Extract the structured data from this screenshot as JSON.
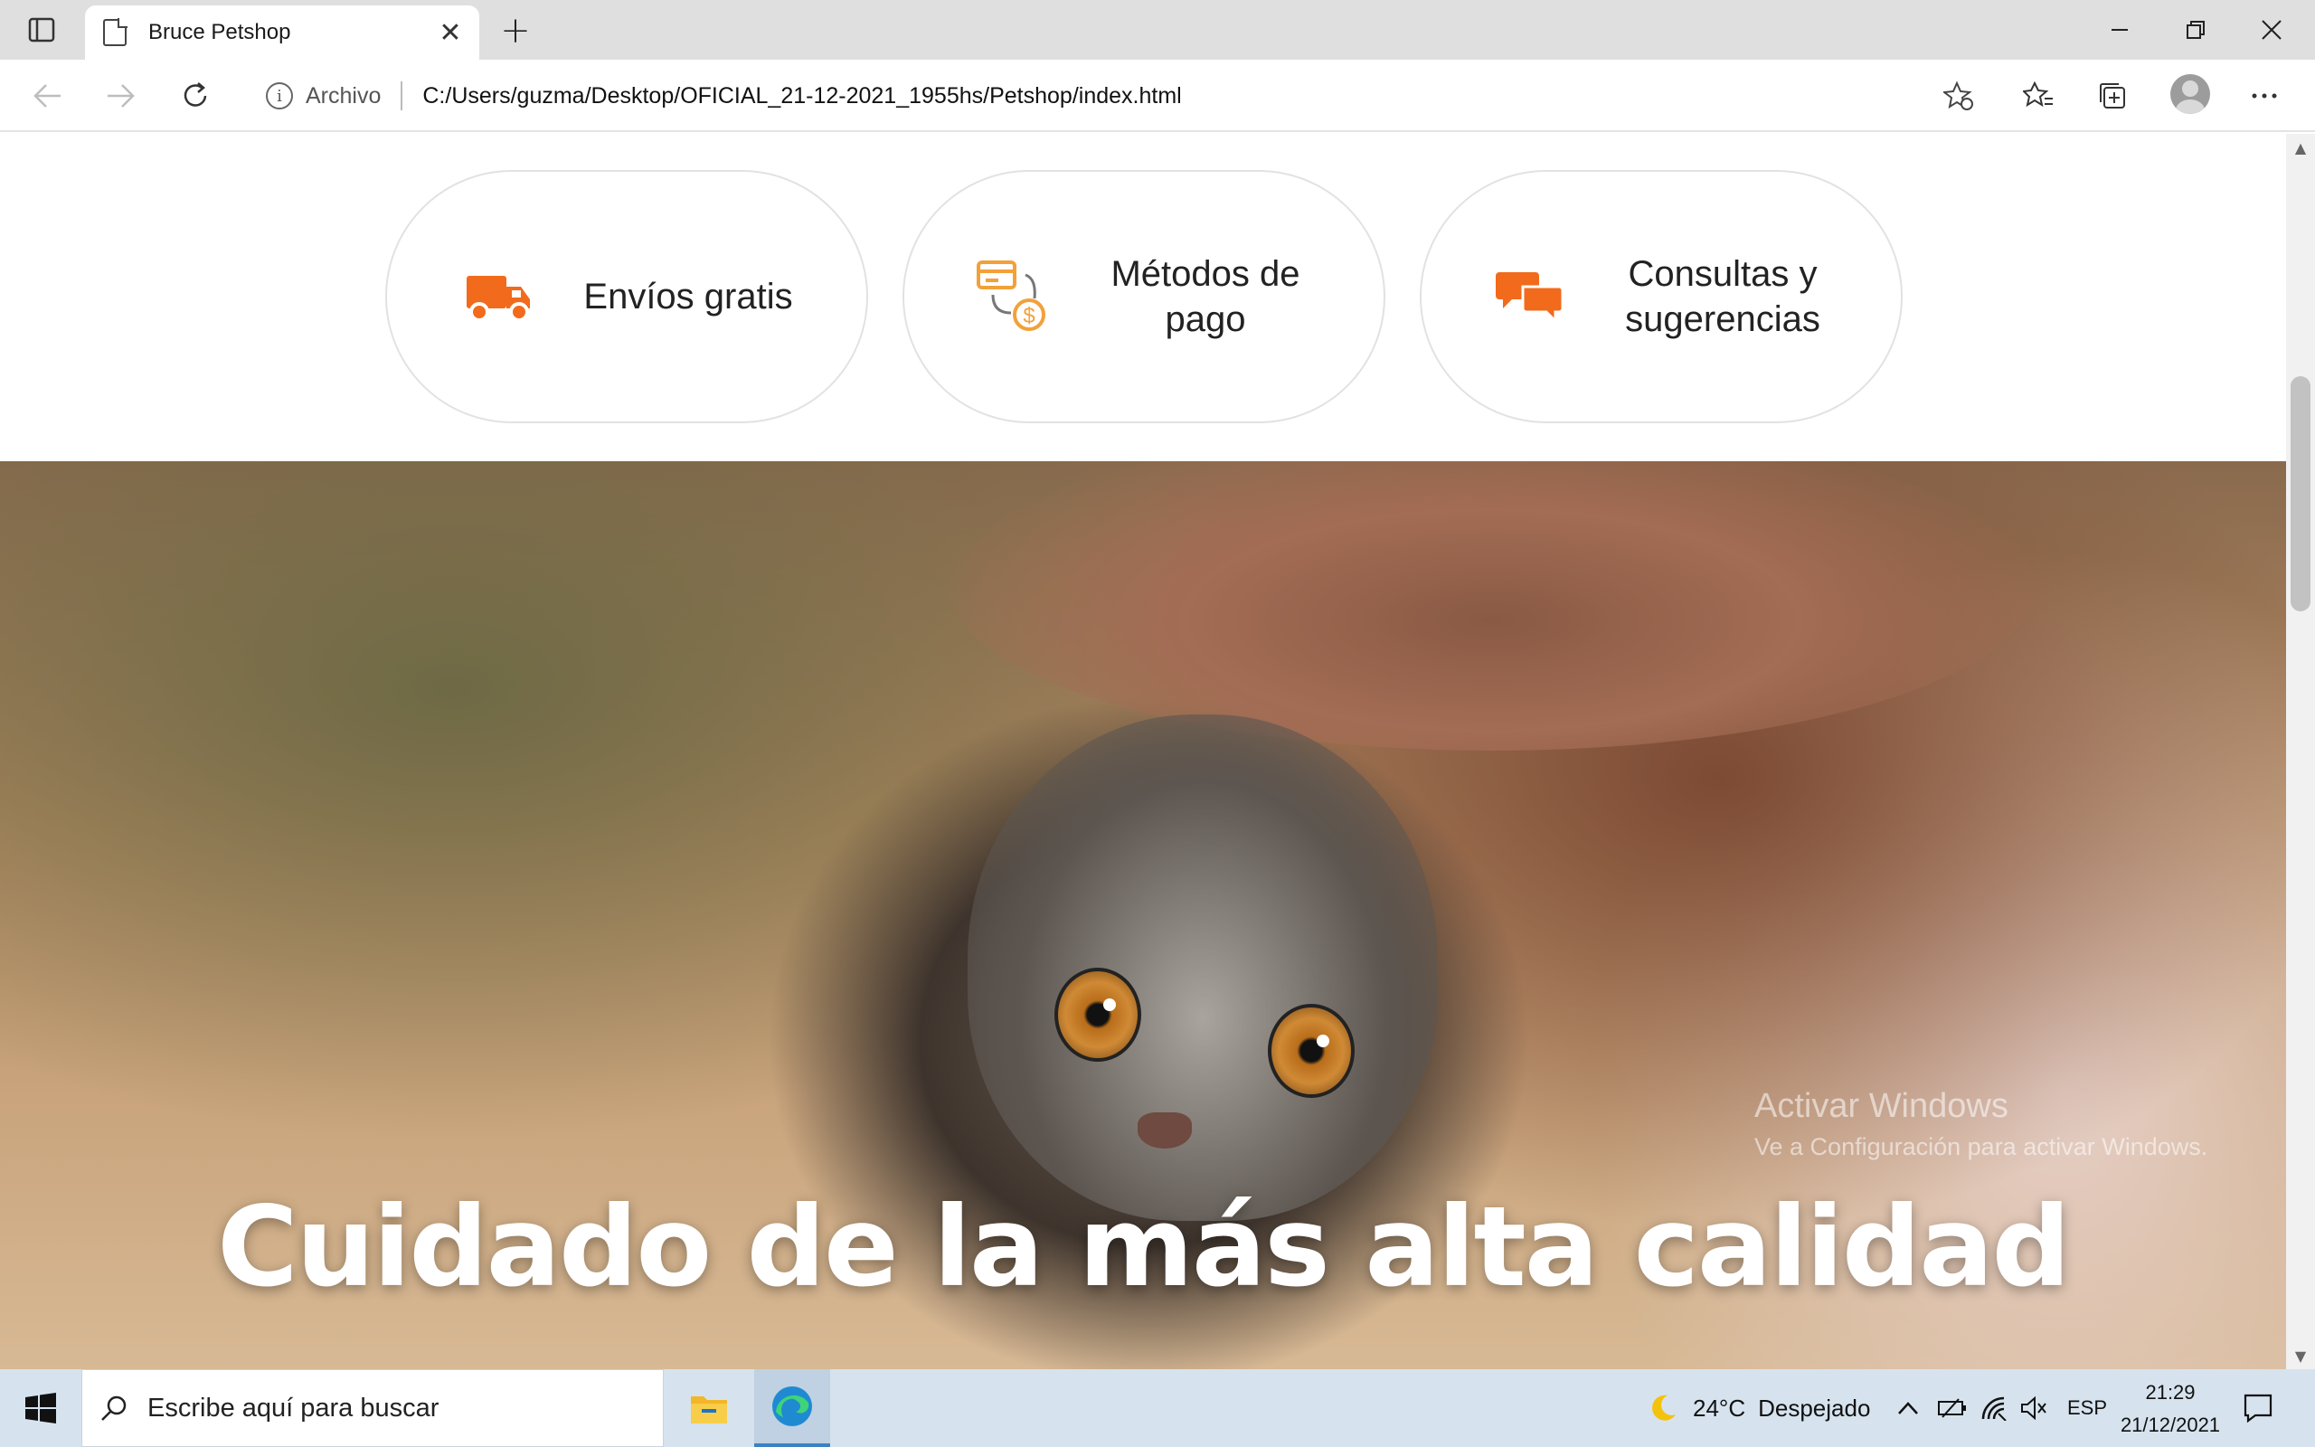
{
  "browser": {
    "tab_title": "Bruce Petshop",
    "close_tab": "✕",
    "new_tab": "+",
    "address_scheme": "Archivo",
    "address_url": "C:/Users/guzma/Desktop/OFICIAL_21-12-2021_1955hs/Petshop/index.html"
  },
  "features": [
    {
      "label": "Envíos gratis",
      "icon": "truck-icon"
    },
    {
      "label": "Métodos de pago",
      "icon": "payment-icon"
    },
    {
      "label": "Consultas y sugerencias",
      "icon": "chat-icon"
    }
  ],
  "hero": {
    "heading": "Cuidado de la más alta calidad"
  },
  "watermark": {
    "line1": "Activar Windows",
    "line2": "Ve a Configuración para activar Windows."
  },
  "taskbar": {
    "search_placeholder": "Escribe aquí para buscar",
    "weather_temp": "24°C",
    "weather_desc": "Despejado",
    "language": "ESP",
    "time": "21:29",
    "date": "21/12/2021"
  },
  "colors": {
    "accent_orange": "#f26a1b",
    "tab_strip": "#dfdfdf",
    "taskbar": "#d6e3ee"
  }
}
